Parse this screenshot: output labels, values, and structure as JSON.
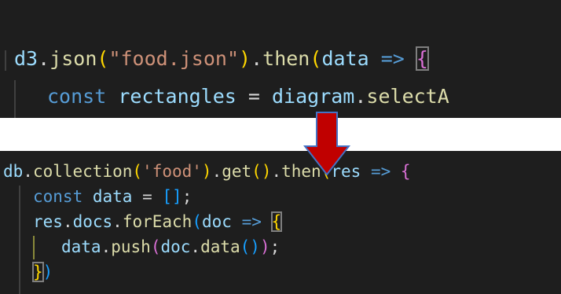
{
  "snippet_before": {
    "line1": {
      "t1": "d3",
      "t2": ".",
      "t3": "json",
      "t4": "(",
      "t5": "\"food.json\"",
      "t6": ")",
      "t7": ".",
      "t8": "then",
      "t9": "(",
      "t10": "data",
      "t11": " => ",
      "t12": "{"
    },
    "line2": {
      "t1": "const",
      "t2": " ",
      "t3": "rectangles",
      "t4": " = ",
      "t5": "diagram",
      "t6": ".",
      "t7": "selectA"
    }
  },
  "arrow": {
    "icon": "down-arrow-icon",
    "fill_color": "#c00000",
    "stroke_color": "#4472c4"
  },
  "snippet_after": {
    "line1": {
      "t1": "db",
      "t2": ".",
      "t3": "collection",
      "t4": "(",
      "t5": "'food'",
      "t6": ")",
      "t7": ".",
      "t8": "get",
      "t9": "(",
      "t10": ")",
      "t11": ".",
      "t12": "then",
      "t13": "(",
      "t14": "res",
      "t15": " => ",
      "t16": "{"
    },
    "line2": {
      "t1": "const",
      "t2": " ",
      "t3": "data",
      "t4": " = ",
      "t5": "[",
      "t6": "]",
      "t7": ";"
    },
    "line3": {
      "t1": "res",
      "t2": ".",
      "t3": "docs",
      "t4": ".",
      "t5": "forEach",
      "t6": "(",
      "t7": "doc",
      "t8": " => ",
      "t9": "{"
    },
    "line4": {
      "t1": "data",
      "t2": ".",
      "t3": "push",
      "t4": "(",
      "t5": "doc",
      "t6": ".",
      "t7": "data",
      "t8": "(",
      "t9": ")",
      "t10": ")",
      "t11": ";"
    },
    "line5": {
      "t1": "}",
      "t2": ")"
    }
  },
  "colors": {
    "editor_bg": "#1e1e1e",
    "keyword": "#569cd6",
    "variable": "#9cdcfe",
    "function": "#dcdcaa",
    "string": "#ce9178",
    "bracket_level1": "#ffd700",
    "bracket_level2": "#da70d6",
    "bracket_level3": "#179fff"
  }
}
